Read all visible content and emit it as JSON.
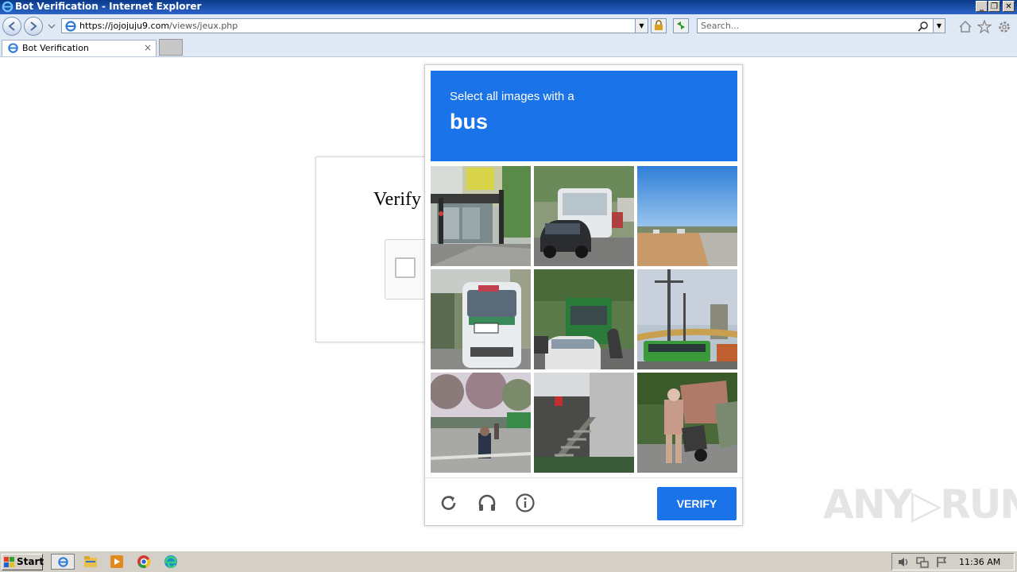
{
  "window": {
    "title": "Bot Verification - Internet Explorer",
    "buttons": [
      "_",
      "❐",
      "✕"
    ]
  },
  "navbar": {
    "url_host": "https://jojojuju9.com",
    "url_path": "/views/jeux.php",
    "search_placeholder": "Search..."
  },
  "tabs": [
    {
      "label": "Bot Verification",
      "close": "×"
    }
  ],
  "page": {
    "verify_text": "Verify"
  },
  "captcha": {
    "instruction": "Select all images with a",
    "target": "bus",
    "tiles": [
      "bus-stop-street",
      "bus-behind-car",
      "empty-road-field",
      "minibus-front",
      "green-bus-traffic",
      "green-bus-bridge",
      "trees-plaza",
      "stairway-building",
      "person-scooter"
    ],
    "footer_icons": [
      "reload-icon",
      "audio-icon",
      "info-icon"
    ],
    "verify_label": "VERIFY",
    "accent": "#1a73e8"
  },
  "watermark": "ANY▷RUN",
  "taskbar": {
    "start_label": "Start",
    "clock": "11:36 AM"
  }
}
